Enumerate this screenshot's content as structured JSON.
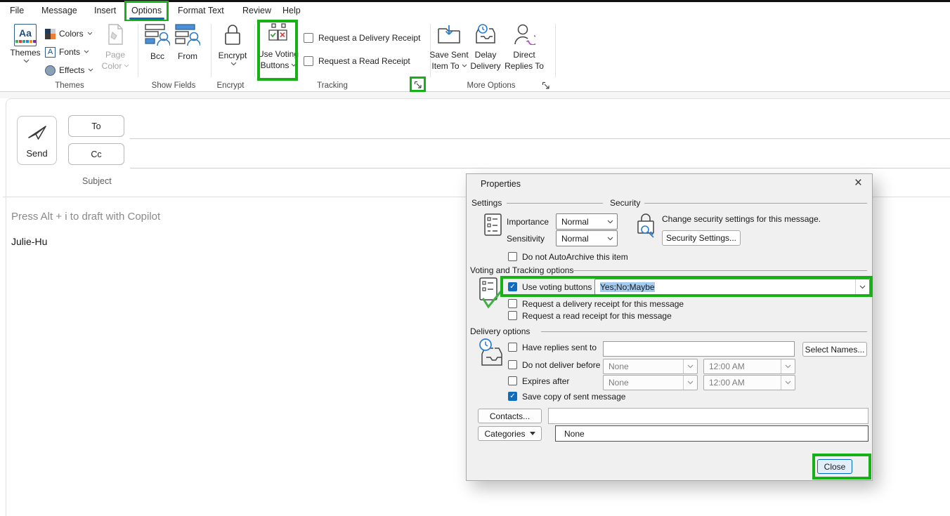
{
  "annotation_color": "#15B115",
  "icons": {
    "close_glyph": "×",
    "check_glyph": "✓",
    "vote_check": "✓",
    "vote_cross": "×",
    "dropdown_triangle": "▾",
    "themes_icon_text": "Aa",
    "fonts_icon_letter": "A"
  },
  "menu": {
    "items": [
      "File",
      "Message",
      "Insert",
      "Options",
      "Format Text",
      "Review",
      "Help"
    ],
    "active": "Options"
  },
  "ribbon": {
    "group_labels": [
      "Themes",
      "Show Fields",
      "Encrypt",
      "Tracking",
      "More Options"
    ],
    "themes": {
      "button_label": "Themes",
      "colors_label": "Colors",
      "fonts_label": "Fonts",
      "effects_label": "Effects",
      "page_color_line1": "Page",
      "page_color_line2": "Color"
    },
    "show_fields": {
      "bcc_label": "Bcc",
      "from_label": "From"
    },
    "encrypt": {
      "button_label": "Encrypt"
    },
    "tracking": {
      "voting_line1": "Use Voting",
      "voting_line2": "Buttons",
      "delivery_receipt_label": "Request a Delivery Receipt",
      "read_receipt_label": "Request a Read Receipt"
    },
    "more_options": {
      "save_line1": "Save Sent",
      "save_line2": "Item To",
      "delay_line1": "Delay",
      "delay_line2": "Delivery",
      "direct_line1": "Direct",
      "direct_line2": "Replies To"
    }
  },
  "compose": {
    "send_label": "Send",
    "to_label": "To",
    "cc_label": "Cc",
    "subject_label": "Subject",
    "copilot_hint": "Press Alt + i to draft with Copilot",
    "body_text": "Julie-Hu"
  },
  "dialog": {
    "title": "Properties",
    "sections": {
      "settings": "Settings",
      "security": "Security",
      "voting": "Voting and Tracking options",
      "delivery": "Delivery options"
    },
    "settings": {
      "importance_label": "Importance",
      "importance_value": "Normal",
      "sensitivity_label": "Sensitivity",
      "sensitivity_value": "Normal",
      "autoarchive_label": "Do not AutoArchive this item"
    },
    "security": {
      "description": "Change security settings for this message.",
      "button_label": "Security Settings..."
    },
    "voting": {
      "use_label": "Use voting buttons",
      "value": "Yes;No;Maybe",
      "delivery_receipt_label": "Request a delivery receipt for this message",
      "read_receipt_label": "Request a read receipt for this message"
    },
    "delivery": {
      "have_replies_label": "Have replies sent to",
      "select_names_label": "Select Names...",
      "do_not_deliver_label": "Do not deliver before",
      "expires_label": "Expires after",
      "none_value": "None",
      "time_value": "12:00 AM",
      "save_copy_label": "Save copy of sent message"
    },
    "footer": {
      "contacts_label": "Contacts...",
      "categories_label": "Categories",
      "categories_value": "None",
      "close_label": "Close"
    }
  }
}
